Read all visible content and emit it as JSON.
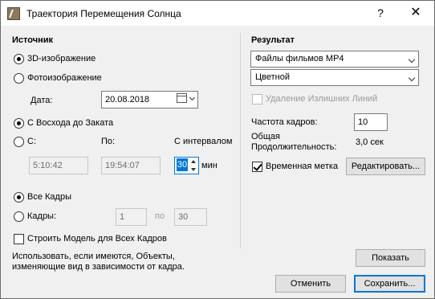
{
  "window": {
    "title": "Траектория Перемещения Солнца",
    "help": "?",
    "close": "✕"
  },
  "source": {
    "heading": "Источник",
    "image_type": [
      {
        "label": "3D-изображение",
        "selected": true
      },
      {
        "label": "Фотоизображение",
        "selected": false
      }
    ],
    "date_label": "Дата:",
    "date_value": "20.08.2018",
    "time_range": [
      {
        "label": "С Восхода до Заката",
        "selected": true
      },
      {
        "label": "С:",
        "selected": false
      }
    ],
    "to_label": "По:",
    "interval_label": "С интервалом",
    "from_time": "5:10:42",
    "to_time": "19:54:07",
    "interval_value": "30",
    "interval_unit": "мин",
    "frames": [
      {
        "label": "Все Кадры",
        "selected": true
      },
      {
        "label": "Кадры:",
        "selected": false
      }
    ],
    "frame_from": "1",
    "frame_to_label": "по",
    "frame_to": "30",
    "build_all_label": "Строить Модель для Всех Кадров",
    "build_all_checked": false,
    "note_line1": "Использовать, если имеются, Объекты,",
    "note_line2": "изменяющие вид в зависимости от кадра."
  },
  "result": {
    "heading": "Результат",
    "format_value": "Файлы фильмов MP4",
    "color_value": "Цветной",
    "remove_lines_label": "Удаление Излишних Линий",
    "remove_lines_checked": false,
    "fps_label": "Частота кадров:",
    "fps_value": "10",
    "duration_label_1": "Общая",
    "duration_label_2": "Продолжительность:",
    "duration_value": "3,0 сек",
    "timestamp_label": "Временная метка",
    "timestamp_checked": true,
    "edit_button": "Редактировать..."
  },
  "buttons": {
    "show": "Показать",
    "cancel": "Отменить",
    "save": "Сохранить..."
  },
  "colors": {
    "accent": "#0078d7",
    "dialog_bg": "#f0f0f0"
  }
}
